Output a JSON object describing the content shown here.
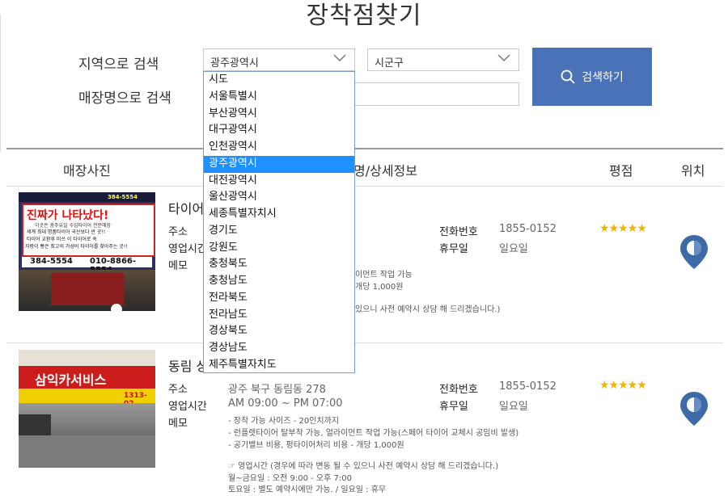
{
  "page": {
    "title": "장착점찾기"
  },
  "search": {
    "region_label": "지역으로 검색",
    "store_label": "매장명으로 검색",
    "sido_value": "광주광역시",
    "sigungu_value": "시군구",
    "store_value": "",
    "button_label": "검색하기"
  },
  "dropdown": {
    "options": [
      "시도",
      "서울특별시",
      "부산광역시",
      "대구광역시",
      "인천광역시",
      "광주광역시",
      "대전광역시",
      "울산광역시",
      "세종특별자치시",
      "경기도",
      "강원도",
      "충청북도",
      "충청남도",
      "전라북도",
      "전라남도",
      "경상북도",
      "경상남도",
      "제주특별자치도"
    ],
    "selected": "광주광역시"
  },
  "table": {
    "headers": {
      "photo": "매장사진",
      "info": "명/상세정보",
      "rating": "평점",
      "location": "위치"
    }
  },
  "stores": [
    {
      "name_visible": "타이어",
      "address_label": "주소",
      "hours_label": "영업시간",
      "memo_label": "메모",
      "memo_lines": [
        "이먼트 작업 가능",
        "개당 1,000원",
        "있으니 사전 예약시 상담 해 드리겠습니다.)"
      ],
      "phone_label": "전화번호",
      "phone": "1855-0152",
      "holiday_label": "휴무일",
      "holiday": "일요일",
      "stars": "★★★★★",
      "photo": {
        "banner_main": "진짜가 나타났다!",
        "banner_sub": "이곳은 광주유일 수입타이어 전문매장",
        "line1": "세계 최대 명품타이어 국산보다 싼 곳!!",
        "line2": "타이어 교환후 미쓰 이 타이어로 속",
        "line3": "자랑이 빵은 최고의 가성비 타이어를 찾아주는 곳!!",
        "phone_left": "384-5554",
        "phone_right": "010-8866-5554",
        "top_phone": "384-5554"
      }
    },
    {
      "name_visible": "동림 상",
      "address_label": "주소",
      "address": "광주 북구 동림동 278",
      "hours_label": "영업시간",
      "hours": "AM 09:00 ~ PM 07:00",
      "memo_label": "메모",
      "memo_lines": [
        "- 장착 가능 사이즈 - 20인치까지",
        "- 런플렛타이어 탈부착 가능, 얼라이먼트 작업 가능(스페어 타이어 교체시 공임비 발생)",
        "- 공기밸브 비용, 펑타이어처리 비용 - 개당 1,000원",
        "",
        "☞ 영업시간 (경우에 따라 변동 될 수 있으니 사전 예약시 상담 해 드리겠습니다.)",
        "월~금요일 : 오전 9:00 - 오후 7:00",
        "토요일 : 별도 예약시에만 가능. / 일요일 : 휴무"
      ],
      "phone_label": "전화번호",
      "phone": "1855-0152",
      "holiday_label": "휴무일",
      "holiday": "일요일",
      "stars": "★★★★★",
      "photo": {
        "sign_main": "삼익카서비스",
        "sign_phone": "1313-02"
      }
    }
  ]
}
